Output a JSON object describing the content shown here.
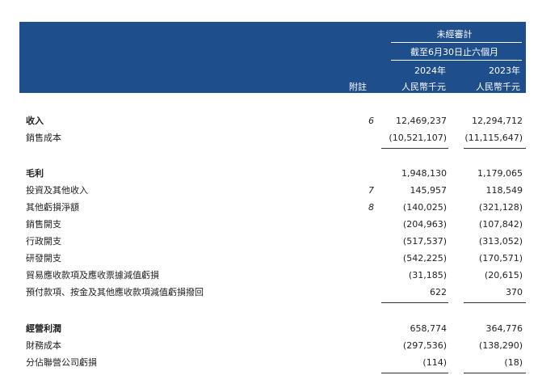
{
  "header": {
    "unaudited": "未經審計",
    "period": "截至6月30日止六個月",
    "note_label": "附註",
    "year_2024": "2024年",
    "year_2023": "2023年",
    "currency_2024": "人民幣千元",
    "currency_2023": "人民幣千元"
  },
  "rows": [
    {
      "label": "收入",
      "note": "6",
      "v2024": "12,469,237",
      "v2023": "12,294,712",
      "bold": true
    },
    {
      "label": "銷售成本",
      "note": "",
      "v2024": "(10,521,107)",
      "v2023": "(11,115,647)",
      "bold": false
    },
    {
      "label": "毛利",
      "note": "",
      "v2024": "1,948,130",
      "v2023": "1,179,065",
      "bold": true
    },
    {
      "label": "投資及其他收入",
      "note": "7",
      "v2024": "145,957",
      "v2023": "118,549",
      "bold": false
    },
    {
      "label": "其他虧損淨額",
      "note": "8",
      "v2024": "(140,025)",
      "v2023": "(321,128)",
      "bold": false
    },
    {
      "label": "銷售開支",
      "note": "",
      "v2024": "(204,963)",
      "v2023": "(107,842)",
      "bold": false
    },
    {
      "label": "行政開支",
      "note": "",
      "v2024": "(517,537)",
      "v2023": "(313,052)",
      "bold": false
    },
    {
      "label": "研發開支",
      "note": "",
      "v2024": "(542,225)",
      "v2023": "(170,571)",
      "bold": false
    },
    {
      "label": "貿易應收款項及應收票據減值虧損",
      "note": "",
      "v2024": "(31,185)",
      "v2023": "(20,615)",
      "bold": false
    },
    {
      "label": "預付款項、按金及其他應收款項減值虧損撥回",
      "note": "",
      "v2024": "622",
      "v2023": "370",
      "bold": false
    },
    {
      "label": "經營利潤",
      "note": "",
      "v2024": "658,774",
      "v2023": "364,776",
      "bold": true
    },
    {
      "label": "財務成本",
      "note": "",
      "v2024": "(297,536)",
      "v2023": "(138,290)",
      "bold": false
    },
    {
      "label": "分佔聯營公司虧損",
      "note": "",
      "v2024": "(114)",
      "v2023": "(18)",
      "bold": false
    }
  ]
}
